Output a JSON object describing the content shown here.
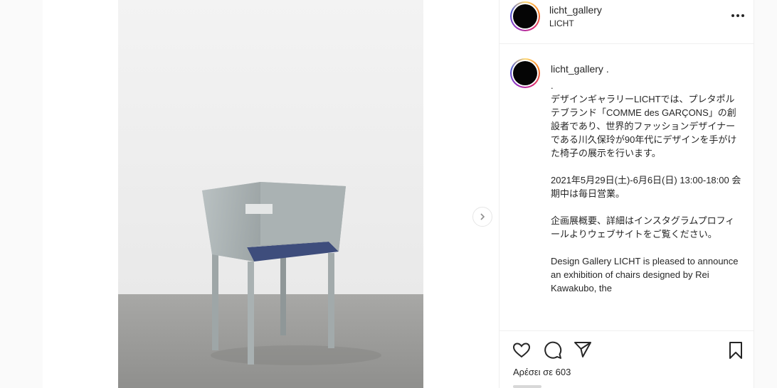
{
  "post": {
    "username": "licht_gallery",
    "location": "LICHT",
    "image_alt": "Galvanized metal chair with blue seat against white wall on concrete floor"
  },
  "comment": {
    "username": "licht_gallery .",
    "caption": ".\nデザインギャラリーLICHTでは、プレタポルテブランド「COMME des GARÇONS」の創設者であり、世界的ファッションデザイナーである川久保玲が90年代にデザインを手がけた椅子の展示を行います。\n\n2021年5月29日(土)-6月6日(日) 13:00-18:00  会期中は毎日営業。\n\n企画展概要、詳細はインスタグラムプロフィールよりウェブサイトをご覧ください。\n\nDesign Gallery LICHT is pleased to announce an exhibition of chairs designed by Rei Kawakubo, the"
  },
  "actions": {
    "likes_text": "Αρέσει σε 603"
  },
  "icons": {
    "more": "more-options-icon",
    "like": "heart-icon",
    "comment": "comment-icon",
    "share": "paper-plane-icon",
    "save": "bookmark-icon",
    "next": "chevron-right-icon"
  }
}
